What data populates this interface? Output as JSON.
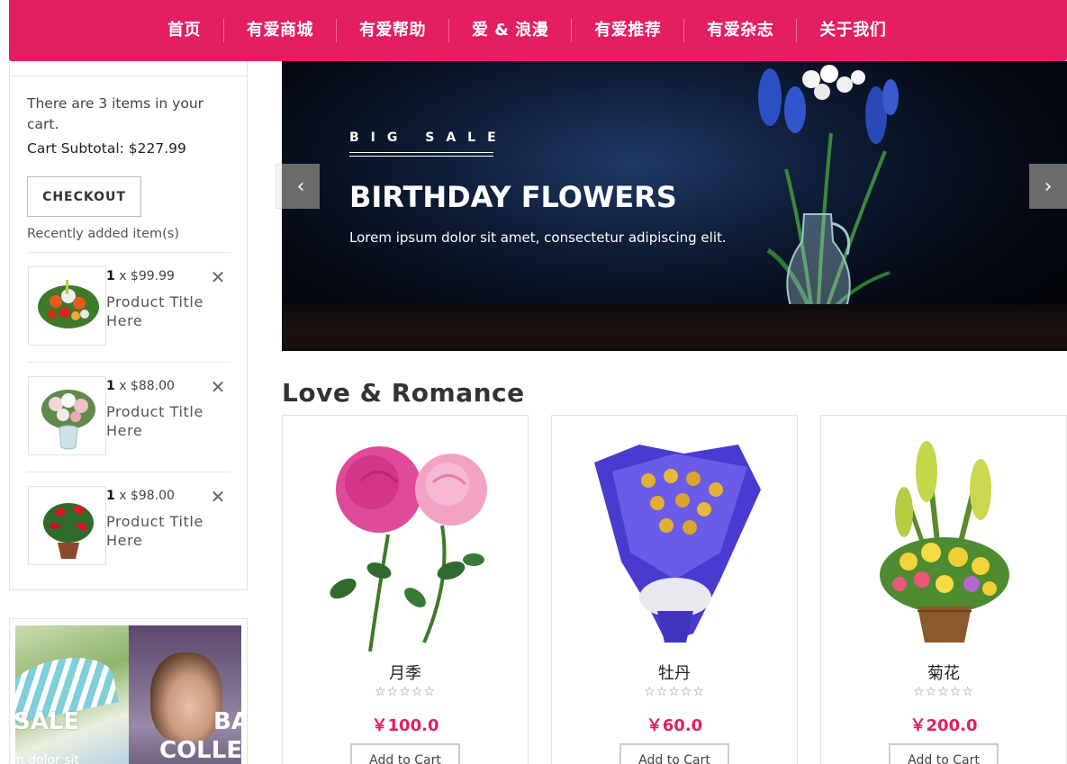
{
  "nav": {
    "items": [
      "首页",
      "有爱商城",
      "有爱帮助",
      "爱 & 浪漫",
      "有爱推荐",
      "有爱杂志",
      "关于我们"
    ]
  },
  "cart": {
    "summary": "There are 3 items in your cart.",
    "subtotal": "Cart Subtotal: $227.99",
    "checkout_label": "CHECKOUT",
    "recent_label": "Recently added item(s)",
    "items": [
      {
        "qty": "1",
        "price": " x $99.99",
        "title": "Product Title Here",
        "remove": "✕",
        "thumb_icon": "mixed-bouquet-icon"
      },
      {
        "qty": "1",
        "price": " x $88.00",
        "title": "Product Title Here",
        "remove": "✕",
        "thumb_icon": "vase-bouquet-icon"
      },
      {
        "qty": "1",
        "price": " x $98.00",
        "title": "Product Title Here",
        "remove": "✕",
        "thumb_icon": "potted-anthurium-icon"
      }
    ]
  },
  "promo": {
    "left_text": "SALE",
    "left_sub": "m dolor sit",
    "right_text_1": "BA",
    "right_text_2": "COLLE"
  },
  "hero": {
    "kicker": "BIG SALE",
    "title": "BIRTHDAY FLOWERS",
    "description": "Lorem ipsum dolor sit amet, consectetur adipiscing elit.",
    "prev_icon": "‹",
    "next_icon": "›"
  },
  "section": {
    "title": "Love & Romance"
  },
  "products": [
    {
      "name": "月季",
      "stars": "☆☆☆☆☆",
      "price": "￥100.0",
      "button": "Add to Cart",
      "image_icon": "pink-roses-icon"
    },
    {
      "name": "牡丹",
      "stars": "☆☆☆☆☆",
      "price": "￥60.0",
      "button": "Add to Cart",
      "image_icon": "blue-chocolate-bouquet-icon"
    },
    {
      "name": "菊花",
      "stars": "☆☆☆☆☆",
      "price": "￥200.0",
      "button": "Add to Cart",
      "image_icon": "flower-basket-icon"
    }
  ],
  "colors": {
    "brand": "#e41e63",
    "text": "#333333"
  }
}
